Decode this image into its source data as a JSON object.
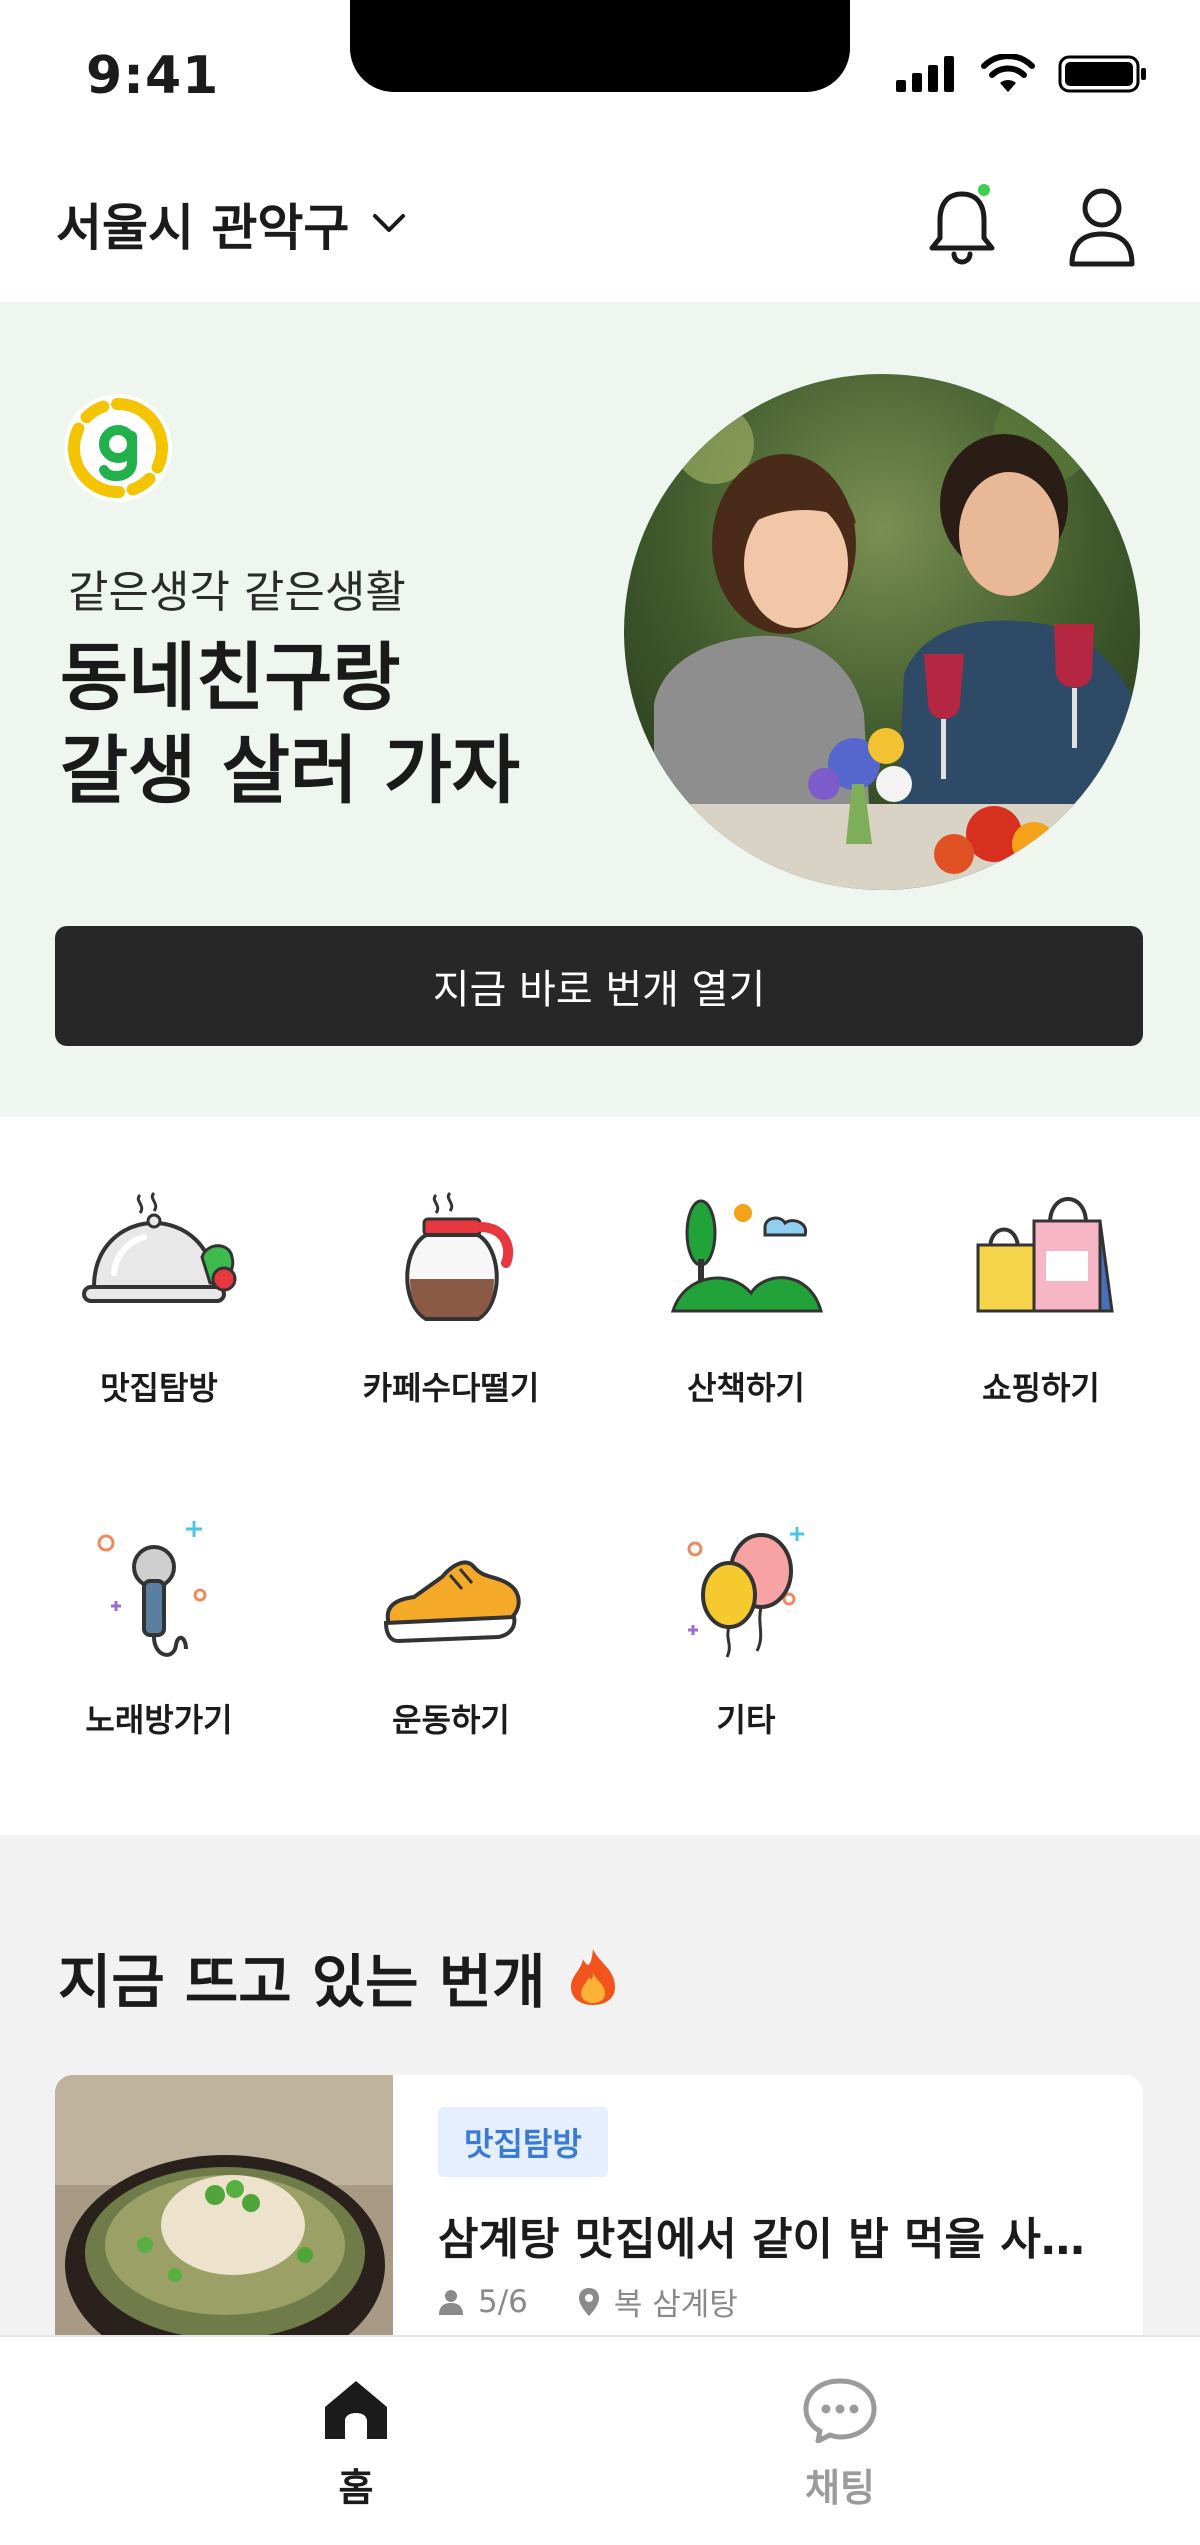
{
  "status_bar": {
    "time": "9:41"
  },
  "header": {
    "location": "서울시 관악구"
  },
  "hero": {
    "subtitle": "같은생각 같은생활",
    "title_line1": "동네친구랑",
    "title_line2": "갈생 살러 가자",
    "cta_label": "지금 바로 번개 열기"
  },
  "categories": [
    {
      "label": "맛집탐방",
      "icon": "restaurant-cloche-icon"
    },
    {
      "label": "카페수다떨기",
      "icon": "coffee-pot-icon"
    },
    {
      "label": "산책하기",
      "icon": "park-walk-icon"
    },
    {
      "label": "쇼핑하기",
      "icon": "shopping-bags-icon"
    },
    {
      "label": "노래방가기",
      "icon": "microphone-icon"
    },
    {
      "label": "운동하기",
      "icon": "sneaker-icon"
    },
    {
      "label": "기타",
      "icon": "balloons-icon"
    }
  ],
  "hot_section": {
    "title": "지금 뜨고 있는 번개",
    "cards": [
      {
        "tag": "맛집탐방",
        "title": "삼계탕 맛집에서 같이 밥 먹을 사…",
        "participants": "5/6",
        "place": "복 삼계탕"
      }
    ]
  },
  "tabbar": {
    "items": [
      {
        "label": "홈",
        "active": true
      },
      {
        "label": "채팅",
        "active": false
      }
    ]
  },
  "colors": {
    "hero_bg": "#eef6ef",
    "cta_bg": "#272727",
    "tag_bg": "#e5efff",
    "tag_text": "#3a7bd5",
    "section_bg": "#f2f2f2",
    "inactive_tab": "#9b9b9b",
    "notification_dot": "#3ecf4f"
  }
}
